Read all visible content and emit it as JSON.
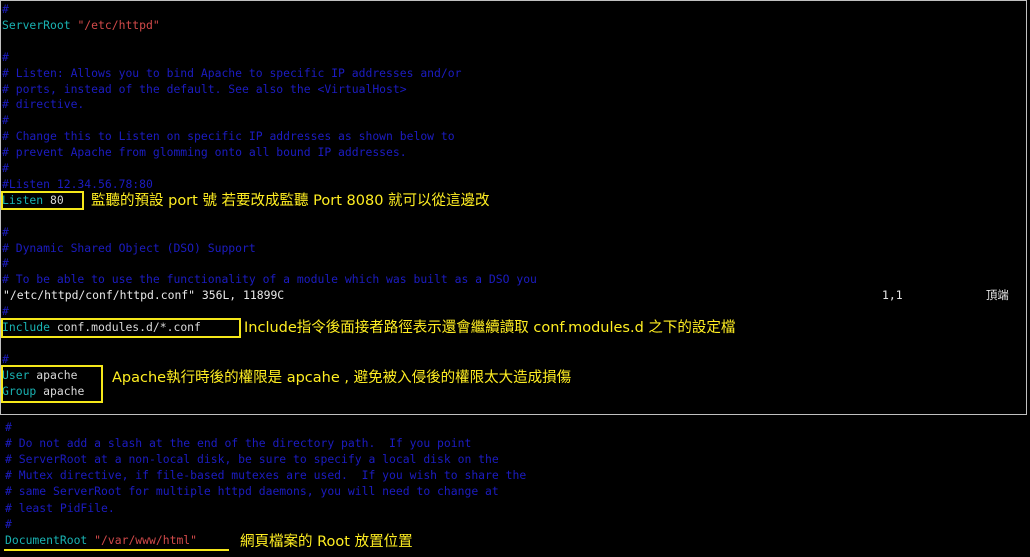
{
  "top_panel": {
    "lines": [
      {
        "type": "comment",
        "text": "#"
      },
      {
        "type": "directive",
        "keyword": "ServerRoot",
        "value": "\"/etc/httpd\""
      },
      {
        "type": "blank",
        "text": ""
      },
      {
        "type": "comment",
        "text": "#"
      },
      {
        "type": "comment",
        "text": "# Listen: Allows you to bind Apache to specific IP addresses and/or"
      },
      {
        "type": "comment",
        "text": "# ports, instead of the default. See also the <VirtualHost>"
      },
      {
        "type": "comment",
        "text": "# directive."
      },
      {
        "type": "comment",
        "text": "#"
      },
      {
        "type": "comment",
        "text": "# Change this to Listen on specific IP addresses as shown below to"
      },
      {
        "type": "comment",
        "text": "# prevent Apache from glomming onto all bound IP addresses."
      },
      {
        "type": "comment",
        "text": "#"
      },
      {
        "type": "comment",
        "text": "#Listen 12.34.56.78:80"
      },
      {
        "type": "directive",
        "keyword": "Listen",
        "value": "80"
      },
      {
        "type": "blank",
        "text": ""
      },
      {
        "type": "comment",
        "text": "#"
      },
      {
        "type": "comment",
        "text": "# Dynamic Shared Object (DSO) Support"
      },
      {
        "type": "comment",
        "text": "#"
      },
      {
        "type": "comment",
        "text": "# To be able to use the functionality of a module which was built as a DSO you"
      }
    ],
    "status_bar": {
      "file": "\"/etc/httpd/conf/httpd.conf\" 356L, 11899C",
      "position": "1,1",
      "scroll": "頂端"
    },
    "lines_after": [
      {
        "type": "comment",
        "text": "#"
      },
      {
        "type": "directive",
        "keyword": "Include",
        "value": "conf.modules.d/*.conf"
      },
      {
        "type": "blank",
        "text": ""
      },
      {
        "type": "comment",
        "text": "#"
      },
      {
        "type": "directive",
        "keyword": "User",
        "value": "apache"
      },
      {
        "type": "directive",
        "keyword": "Group",
        "value": "apache"
      }
    ]
  },
  "bottom_panel": {
    "lines": [
      {
        "type": "comment",
        "text": "#"
      },
      {
        "type": "comment",
        "text": "# Do not add a slash at the end of the directory path.  If you point"
      },
      {
        "type": "comment",
        "text": "# ServerRoot at a non-local disk, be sure to specify a local disk on the"
      },
      {
        "type": "comment",
        "text": "# Mutex directive, if file-based mutexes are used.  If you wish to share the"
      },
      {
        "type": "comment",
        "text": "# same ServerRoot for multiple httpd daemons, you will need to change at"
      },
      {
        "type": "comment",
        "text": "# least PidFile."
      },
      {
        "type": "comment",
        "text": "#"
      },
      {
        "type": "directive",
        "keyword": "DocumentRoot",
        "value": "\"/var/www/html\""
      }
    ]
  },
  "annotations": {
    "listen": "監聽的預設 port 號 若要改成監聽 Port 8080 就可以從這邊改",
    "include": "Include指令後面接者路徑表示還會繼續讀取 conf.modules.d 之下的設定檔",
    "user_group": "Apache執行時後的權限是 apcahe , 避免被入侵後的權限太大造成損傷",
    "document_root": "網頁檔案的 Root 放置位置"
  },
  "colors": {
    "background": "#000000",
    "comment": "#1c1cc2",
    "keyword": "#19b3b3",
    "string": "#d24a4a",
    "plain": "#d8d8d8",
    "highlight": "#f5e71a"
  }
}
